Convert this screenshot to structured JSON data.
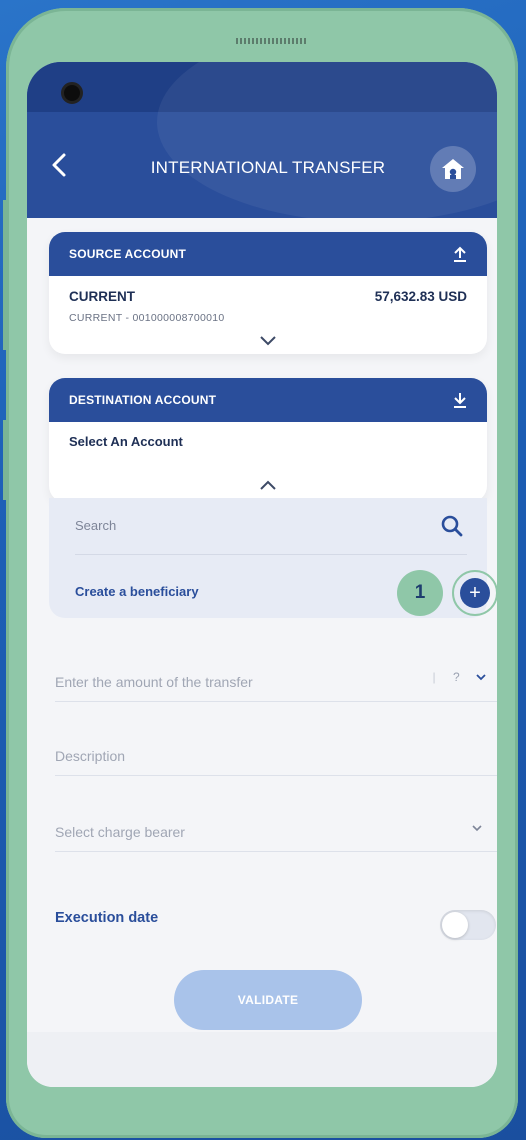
{
  "header": {
    "title": "INTERNATIONAL TRANSFER",
    "back_icon": "chevron-left-icon",
    "home_icon": "home-icon"
  },
  "source_account": {
    "heading": "SOURCE ACCOUNT",
    "name": "CURRENT",
    "account_number": "CURRENT - 001000008700010",
    "balance": "57,632.83 USD"
  },
  "destination_account": {
    "heading": "DESTINATION ACCOUNT",
    "placeholder": "Select An Account"
  },
  "dropdown": {
    "search_placeholder": "Search",
    "create_beneficiary": "Create a beneficiary",
    "step_badge": "1"
  },
  "form": {
    "amount_placeholder": "Enter the amount of the transfer",
    "currency_value": "?",
    "description_placeholder": "Description",
    "charge_bearer_placeholder": "Select charge bearer",
    "execution_date_label": "Execution date",
    "execution_date_enabled": false
  },
  "actions": {
    "validate_label": "VALIDATE"
  },
  "colors": {
    "primary": "#2a4e9b",
    "accent_green": "#8fc7a8",
    "button_disabled": "#a9c3ea"
  }
}
